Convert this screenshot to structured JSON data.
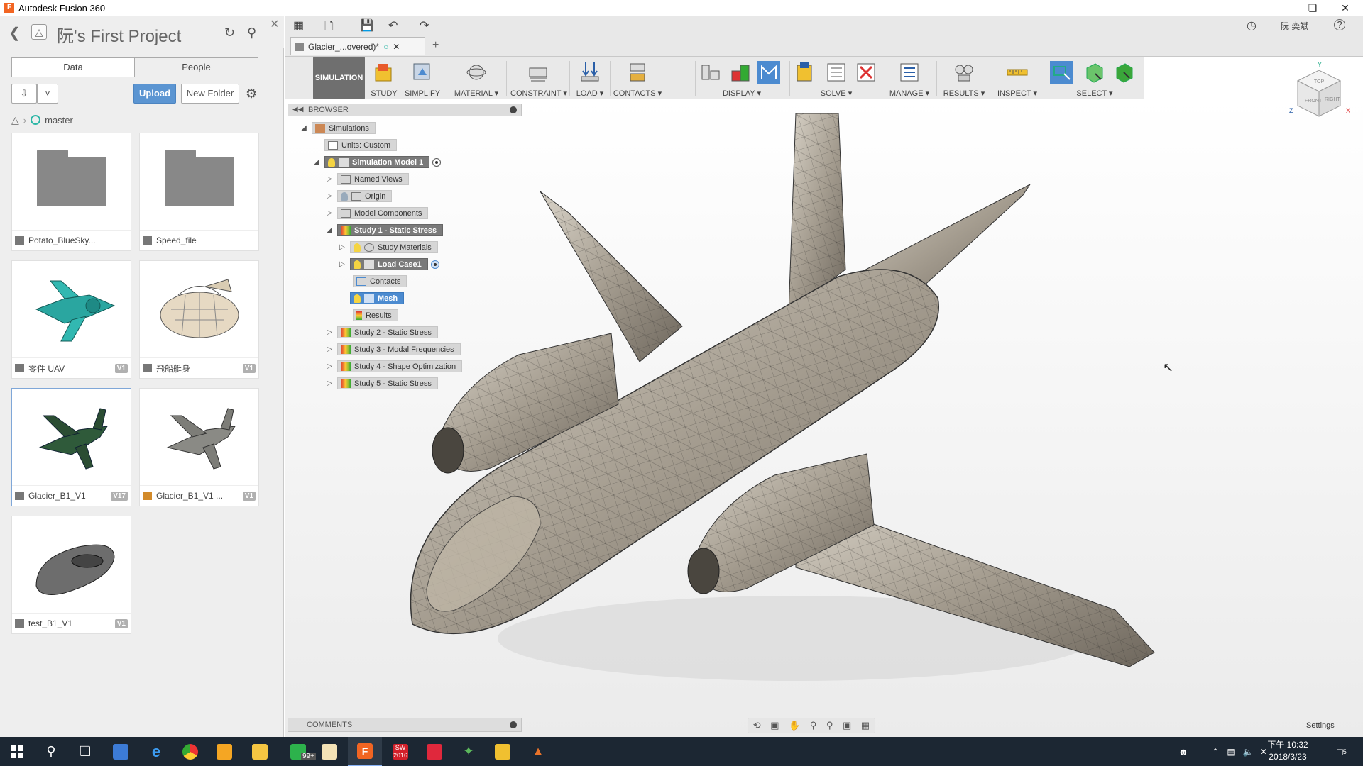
{
  "window": {
    "title": "Autodesk Fusion 360"
  },
  "data_panel": {
    "project_name": "阮's First Project",
    "tabs": [
      "Data",
      "People"
    ],
    "upload_label": "Upload",
    "new_folder_label": "New Folder",
    "breadcrumb": "master",
    "items": [
      {
        "name": "Potato_BlueSky...",
        "version": "",
        "kind": "folder"
      },
      {
        "name": "Speed_file",
        "version": "",
        "kind": "folder"
      },
      {
        "name": "零件 UAV",
        "version": "V1",
        "kind": "design"
      },
      {
        "name": "飛船艇身",
        "version": "V1",
        "kind": "design"
      },
      {
        "name": "Glacier_B1_V1",
        "version": "V17",
        "kind": "design"
      },
      {
        "name": "Glacier_B1_V1 ...",
        "version": "V1",
        "kind": "drawing"
      },
      {
        "name": "test_B1_V1",
        "version": "V1",
        "kind": "design"
      }
    ]
  },
  "header": {
    "user": "阮 奕斌",
    "help": "?"
  },
  "document_tab": {
    "name": "Glacier_...overed)*"
  },
  "toolbar": {
    "workspace": "SIMULATION",
    "groups": [
      "STUDY",
      "SIMPLIFY",
      "MATERIAL",
      "CONSTRAINT",
      "LOAD",
      "CONTACTS",
      "DISPLAY",
      "SOLVE",
      "MANAGE",
      "RESULTS",
      "INSPECT",
      "SELECT"
    ]
  },
  "browser": {
    "title": "BROWSER",
    "nodes": [
      {
        "label": "Simulations"
      },
      {
        "label": "Units: Custom"
      },
      {
        "label": "Simulation Model 1"
      },
      {
        "label": "Named Views"
      },
      {
        "label": "Origin"
      },
      {
        "label": "Model Components"
      },
      {
        "label": "Study 1 - Static Stress"
      },
      {
        "label": "Study Materials"
      },
      {
        "label": "Load Case1"
      },
      {
        "label": "Contacts"
      },
      {
        "label": "Mesh"
      },
      {
        "label": "Results"
      },
      {
        "label": "Study 2 - Static Stress"
      },
      {
        "label": "Study 3 - Modal Frequencies"
      },
      {
        "label": "Study 4 - Shape Optimization"
      },
      {
        "label": "Study 5 - Static Stress"
      }
    ]
  },
  "comments_label": "COMMENTS",
  "settings_label": "Settings",
  "viewcube": {
    "top": "TOP",
    "front": "FRONT",
    "right": "RIGHT",
    "axis_x": "X",
    "axis_y": "Y",
    "axis_z": "Z"
  },
  "taskbar": {
    "time": "下午 10:32",
    "date": "2018/3/23",
    "badge": "99+",
    "sw_label": "SW",
    "sw_year": "2016",
    "notif_count": "5"
  },
  "colors": {
    "accent": "#4c8bd0",
    "toolbar_bg": "#e9e9e9",
    "taskbar_bg": "#1c2733",
    "selected_node": "#7a7a7a"
  }
}
